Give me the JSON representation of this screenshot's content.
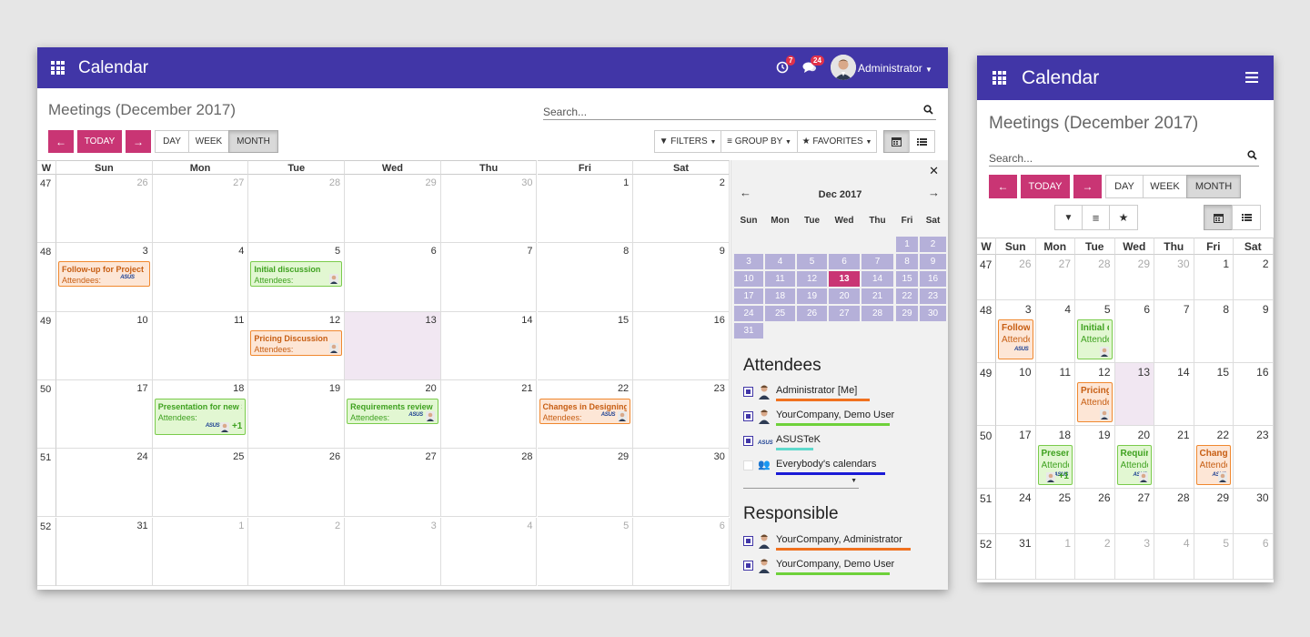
{
  "app": {
    "title": "Calendar",
    "page_title": "Meetings (December 2017)",
    "search_placeholder": "Search..."
  },
  "systray": {
    "activity_count": "7",
    "messages_count": "24",
    "user_name": "Administrator"
  },
  "toolbar": {
    "today_label": "TODAY",
    "day_label": "DAY",
    "week_label": "WEEK",
    "month_label": "MONTH",
    "filters_label": "FILTERS",
    "groupby_label": "GROUP BY",
    "favorites_label": "FAVORITES"
  },
  "grid": {
    "week_header": "W",
    "day_headers": [
      "Sun",
      "Mon",
      "Tue",
      "Wed",
      "Thu",
      "Fri",
      "Sat"
    ],
    "weeks": [
      {
        "week": "47",
        "days": [
          "26",
          "27",
          "28",
          "29",
          "30",
          "1",
          "2"
        ]
      },
      {
        "week": "48",
        "days": [
          "3",
          "4",
          "5",
          "6",
          "7",
          "8",
          "9"
        ]
      },
      {
        "week": "49",
        "days": [
          "10",
          "11",
          "12",
          "13",
          "14",
          "15",
          "16"
        ]
      },
      {
        "week": "50",
        "days": [
          "17",
          "18",
          "19",
          "20",
          "21",
          "22",
          "23"
        ]
      },
      {
        "week": "51",
        "days": [
          "24",
          "25",
          "26",
          "27",
          "28",
          "29",
          "30"
        ]
      },
      {
        "week": "52",
        "days": [
          "31",
          "1",
          "2",
          "3",
          "4",
          "5",
          "6"
        ]
      }
    ]
  },
  "events": [
    {
      "title": "Follow-up for Project p",
      "attendees": "Attendees:",
      "color": "orange"
    },
    {
      "title": "Initial discussion",
      "attendees": "Attendees:",
      "color": "green"
    },
    {
      "title": "Pricing Discussion",
      "attendees": "Attendees:",
      "color": "orange"
    },
    {
      "title": "Presentation for new Sc",
      "attendees": "Attendees:",
      "color": "green",
      "more": "+1"
    },
    {
      "title": "Requirements review",
      "attendees": "Attendees:",
      "color": "green"
    },
    {
      "title": "Changes in Designing",
      "attendees": "Attendees:",
      "color": "orange"
    }
  ],
  "mobile_events": [
    {
      "title": "Follow-",
      "attendees": "Attende"
    },
    {
      "title": "Initial di",
      "attendees": "Attende"
    },
    {
      "title": "Pricing",
      "attendees": "Attende"
    },
    {
      "title": "Present",
      "attendees": "Attende",
      "more": "+1"
    },
    {
      "title": "Require",
      "attendees": "Attende"
    },
    {
      "title": "Change",
      "attendees": "Attende"
    }
  ],
  "mini_calendar": {
    "month_label": "Dec 2017",
    "headers": [
      "Sun",
      "Mon",
      "Tue",
      "Wed",
      "Thu",
      "Fri",
      "Sat"
    ],
    "days": [
      "1",
      "2",
      "3",
      "4",
      "5",
      "6",
      "7",
      "8",
      "9",
      "10",
      "11",
      "12",
      "13",
      "14",
      "15",
      "16",
      "17",
      "18",
      "19",
      "20",
      "21",
      "22",
      "23",
      "24",
      "25",
      "26",
      "27",
      "28",
      "29",
      "30",
      "31"
    ],
    "selected": "13"
  },
  "attendees": {
    "title": "Attendees",
    "items": [
      {
        "label": "Administrator [Me]",
        "checked": true,
        "color": "#f0711f"
      },
      {
        "label": "YourCompany, Demo User",
        "checked": true,
        "color": "#6ed13a"
      },
      {
        "label": "ASUSTeK",
        "checked": true,
        "color": "#5fd9cc"
      },
      {
        "label": "Everybody's calendars",
        "checked": false,
        "color": "#1a1ad6"
      }
    ]
  },
  "responsible": {
    "title": "Responsible",
    "items": [
      {
        "label": "YourCompany, Administrator",
        "checked": true,
        "color": "#f0711f"
      },
      {
        "label": "YourCompany, Demo User",
        "checked": true,
        "color": "#6ed13a"
      }
    ]
  },
  "colors": {
    "brand": "#4136a7",
    "accent": "#c93574",
    "today_bg": "#f1e7f2",
    "mini_cal": "#b5b0d9"
  },
  "logo_text": "ASUS"
}
